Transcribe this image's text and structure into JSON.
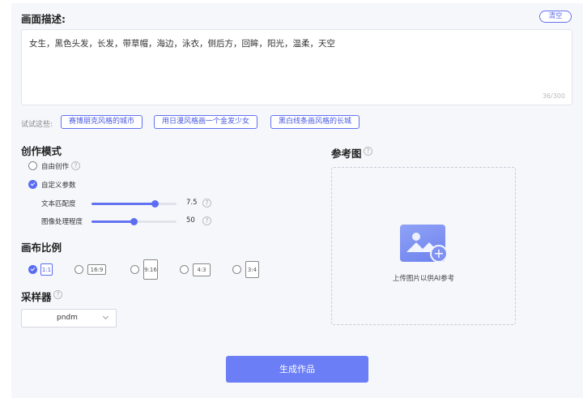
{
  "description": {
    "title": "画面描述:",
    "clear_label": "清空",
    "text": "女生，黑色头发，长发，带草帽，海边，泳衣，侧后方，回眸，阳光，温柔，天空",
    "counter": "36/300"
  },
  "try_these": {
    "label": "试试这些:",
    "chips": [
      "赛博朋克风格的城市",
      "用日漫风格画一个金发少女",
      "黑白线条画风格的长城"
    ]
  },
  "mode": {
    "title": "创作模式",
    "options": [
      {
        "label": "自由创作",
        "checked": false
      },
      {
        "label": "自定义参数",
        "checked": true
      }
    ],
    "sliders": [
      {
        "label": "文本匹配度",
        "value": "7.5",
        "fraction": 0.75
      },
      {
        "label": "图像处理程度",
        "value": "50",
        "fraction": 0.5
      }
    ]
  },
  "ratio": {
    "title": "画布比例",
    "options": [
      {
        "label": "1:1",
        "checked": true
      },
      {
        "label": "16:9",
        "checked": false
      },
      {
        "label": "9:16",
        "checked": false
      },
      {
        "label": "4:3",
        "checked": false
      },
      {
        "label": "3:4",
        "checked": false
      }
    ]
  },
  "sampler": {
    "title": "采样器",
    "value": "pndm"
  },
  "reference": {
    "title": "参考图",
    "upload_text": "上传图片以供AI参考",
    "icon": "image-upload-icon"
  },
  "generate_label": "生成作品",
  "colors": {
    "accent": "#6272f0",
    "button": "#6b7ef5",
    "panel_bg": "#f6f7fb"
  }
}
